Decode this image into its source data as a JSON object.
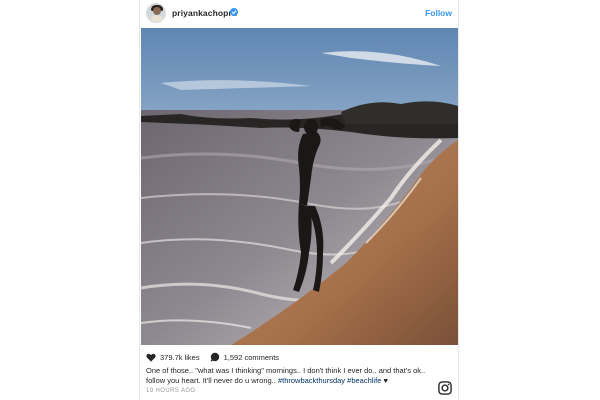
{
  "post": {
    "username": "priyankachopra",
    "follow_label": "Follow",
    "likes": "379.7k likes",
    "comments": "1,592 comments",
    "caption_text": "One of those.. \"what was I thinking\" mornings.. I don't think I ever do.. and that's ok.. follow you heart. It'll never do u wrong..",
    "hashtags": [
      "#throwbackthursday",
      "#beachlife"
    ],
    "caption_end": "♥",
    "timestamp": "19 HOURS AGO"
  },
  "icons": {
    "avatar": "profile-avatar",
    "verified": "verified-badge-icon",
    "like": "heart-icon",
    "comment": "comment-bubble-icon",
    "logo": "instagram-logo-icon"
  },
  "colors": {
    "link": "#3897f0",
    "hashtag": "#003569",
    "text": "#262626",
    "muted": "#999999"
  }
}
